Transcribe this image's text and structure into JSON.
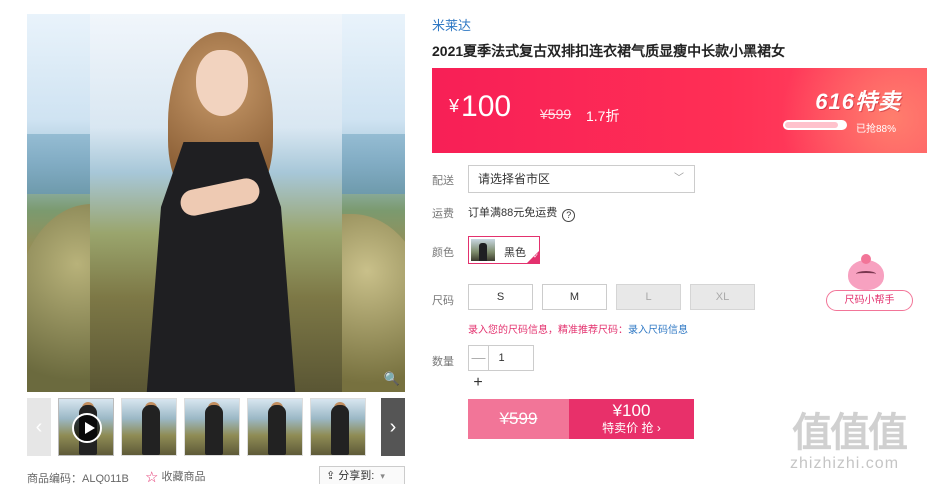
{
  "brand": "米莱达",
  "title": "2021夏季法式复古双排扣连衣裙气质显瘦中长款小黑裙女",
  "price": {
    "currency": "¥",
    "current": "100",
    "original": "¥599",
    "discount": "1.7折",
    "promo_logo": "616特卖",
    "sold_fraction": 0.88,
    "sold_text": "已抢88%"
  },
  "delivery": {
    "label": "配送",
    "placeholder": "请选择省市区"
  },
  "shipping": {
    "label": "运费",
    "text": "订单满88元免运费",
    "help": "?"
  },
  "color": {
    "label": "颜色",
    "selected": "黑色"
  },
  "size": {
    "label": "尺码",
    "options": [
      {
        "label": "S",
        "available": true
      },
      {
        "label": "M",
        "available": true
      },
      {
        "label": "L",
        "available": false
      },
      {
        "label": "XL",
        "available": false
      }
    ],
    "hint": "录入您的尺码信息，精准推荐尺码：",
    "hint_link": "录入尺码信息",
    "helper": "尺码小帮手"
  },
  "quantity": {
    "label": "数量",
    "value": "1",
    "minus": "—",
    "plus": "+"
  },
  "buttons": {
    "original_price": "¥599",
    "special_price": "¥100",
    "special_label": "特卖价 抢 ›"
  },
  "gallery": {
    "sku_code": "商品编码：ALQ011B",
    "favorite": "收藏商品",
    "share": "分享到:",
    "prev_arrow": "‹",
    "next_arrow": "›",
    "thumb_count": 6
  },
  "watermark": {
    "logo": "值值值",
    "site": "zhizhizhi.com"
  },
  "colors": {
    "accent": "#e3316e",
    "banner": "#f71f56",
    "link": "#2f78c4"
  }
}
